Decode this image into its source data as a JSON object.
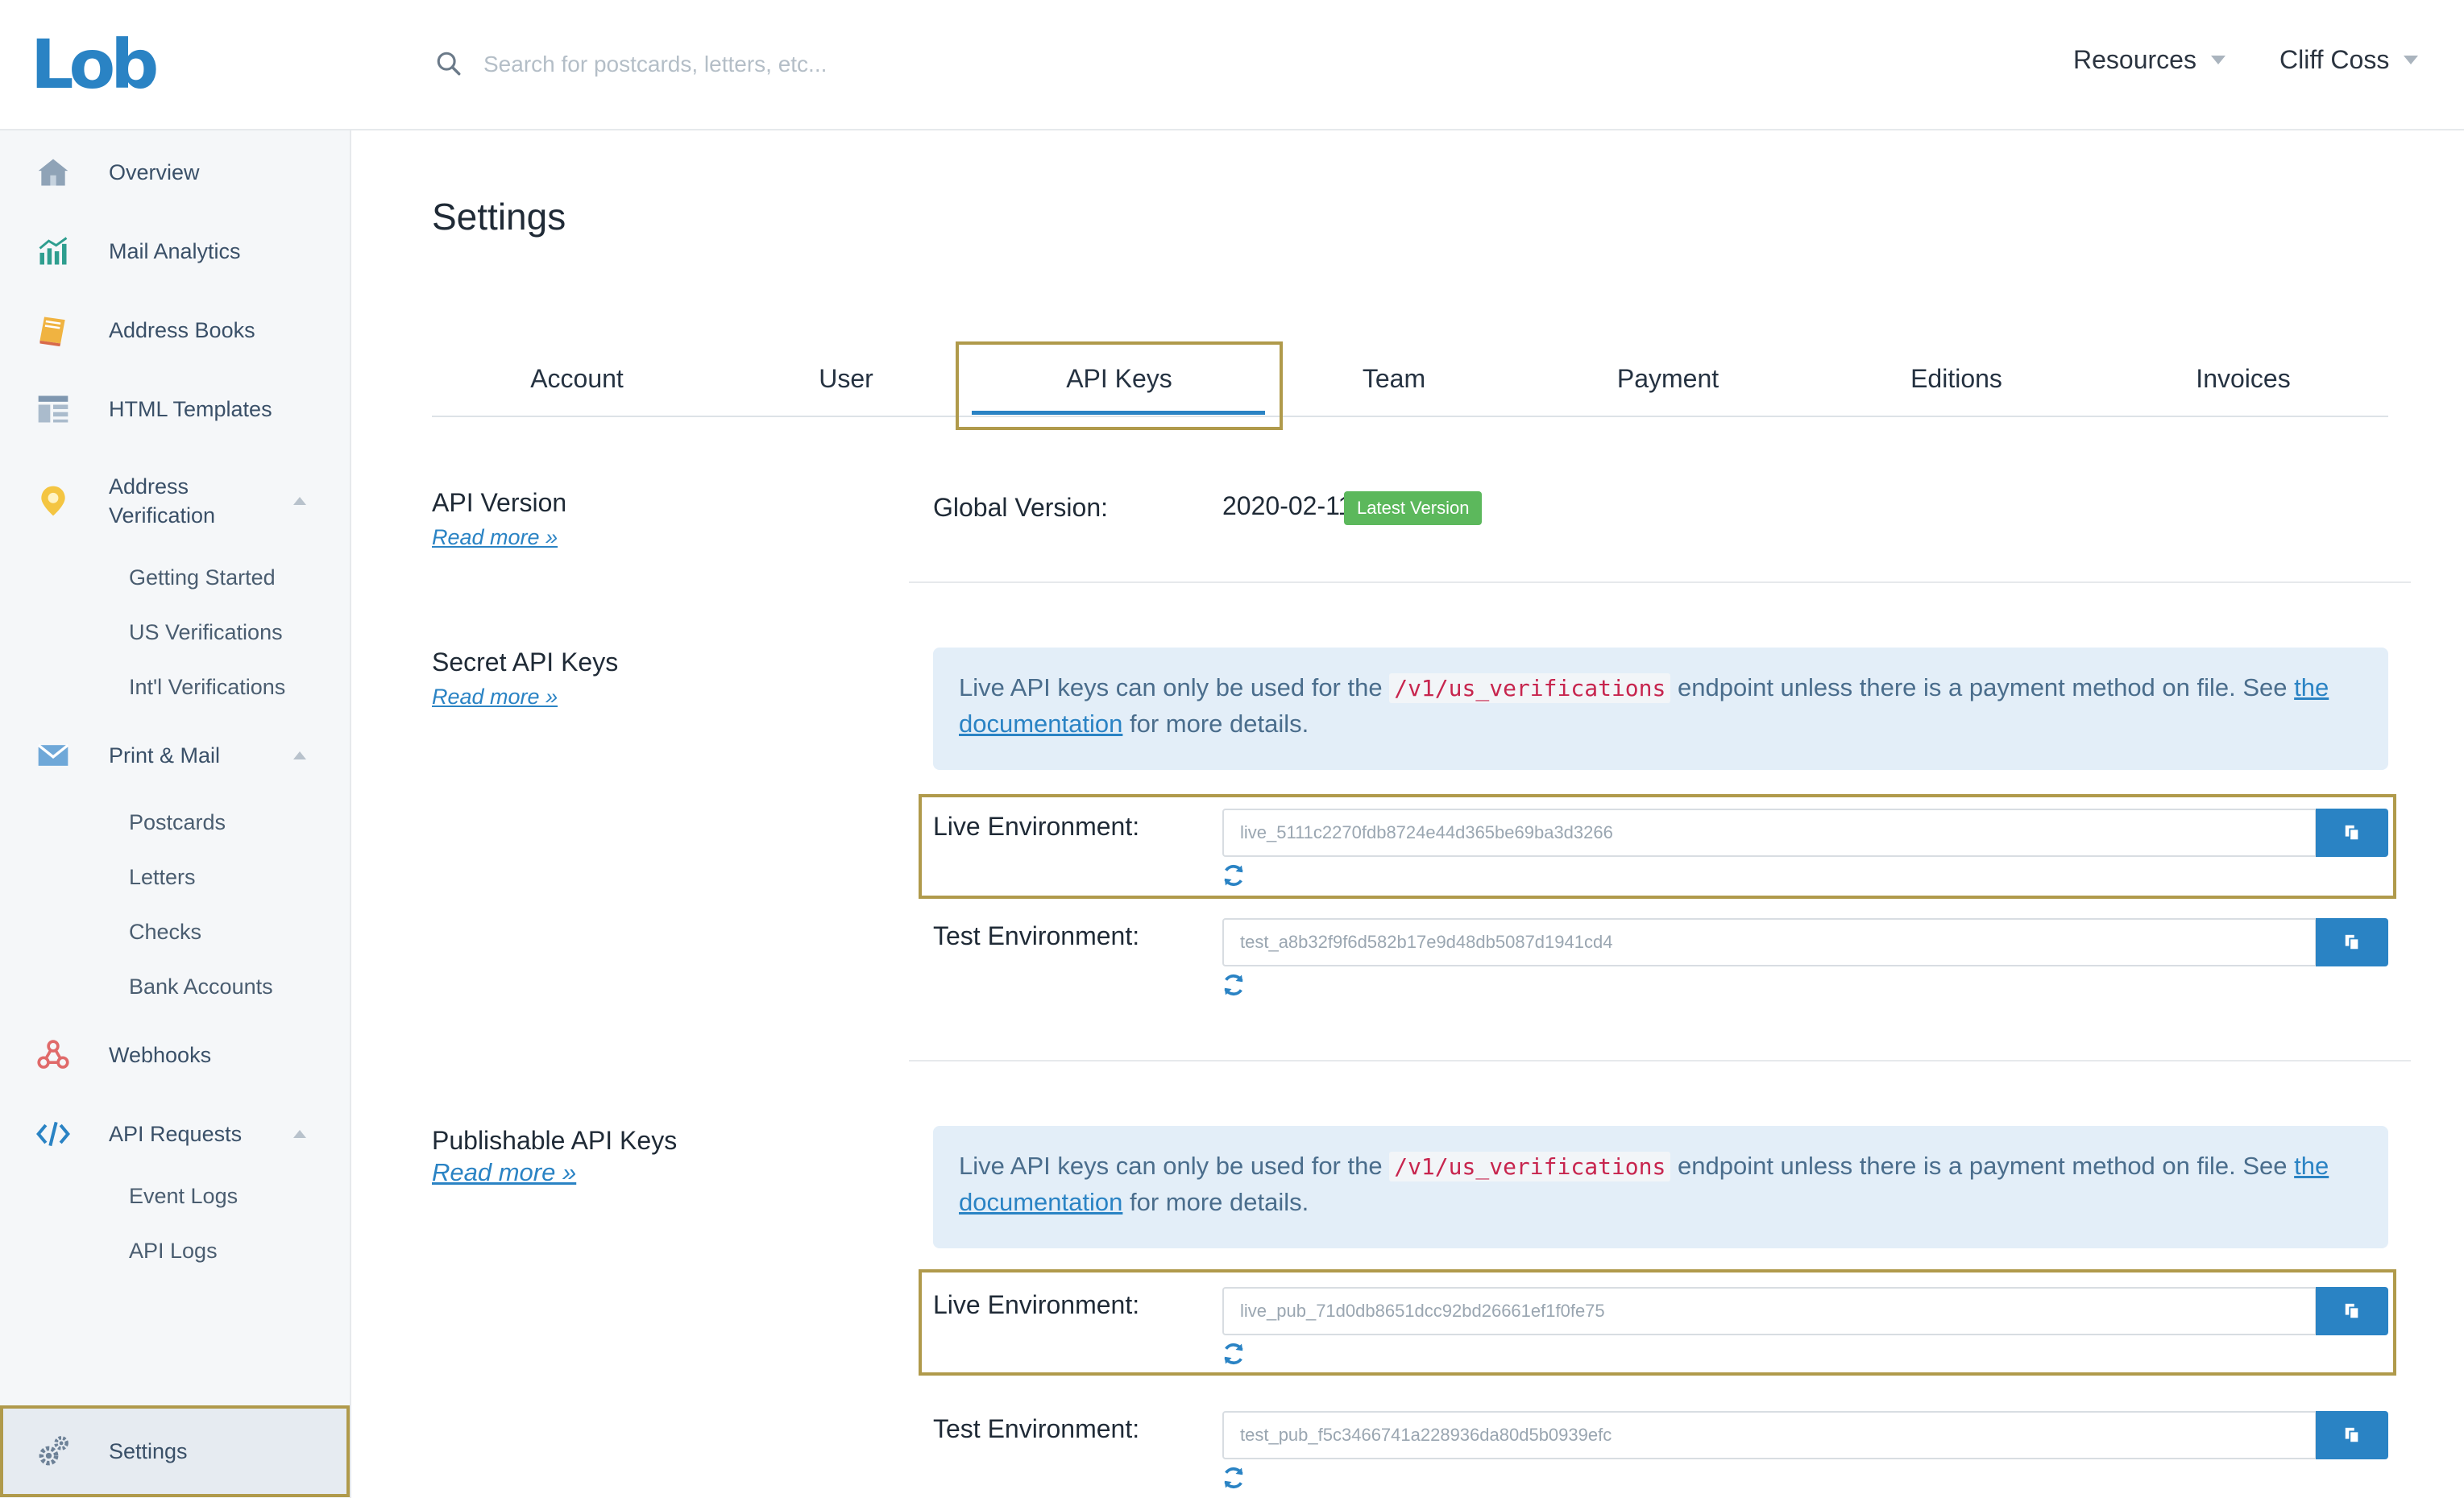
{
  "header": {
    "logo": "Lob",
    "search_placeholder": "Search for postcards, letters, etc...",
    "resources": "Resources",
    "user_name": "Cliff Coss"
  },
  "sidebar": {
    "overview": "Overview",
    "mail_analytics": "Mail Analytics",
    "address_books": "Address Books",
    "html_templates": "HTML Templates",
    "address_verification": "Address Verification",
    "av_sub": [
      "Getting Started",
      "US Verifications",
      "Int'l Verifications"
    ],
    "print_mail": "Print & Mail",
    "pm_sub": [
      "Postcards",
      "Letters",
      "Checks",
      "Bank Accounts"
    ],
    "webhooks": "Webhooks",
    "api_requests": "API Requests",
    "api_sub": [
      "Event Logs",
      "API Logs"
    ],
    "settings": "Settings"
  },
  "page": {
    "title": "Settings",
    "tabs": [
      "Account",
      "User",
      "API Keys",
      "Team",
      "Payment",
      "Editions",
      "Invoices"
    ],
    "active_tab": "API Keys"
  },
  "api_version": {
    "title": "API Version",
    "read_more": "Read more »",
    "label": "Global Version:",
    "value": "2020-02-11",
    "badge": "Latest Version"
  },
  "secret_keys": {
    "title": "Secret API Keys",
    "read_more": "Read more »",
    "notice_pre": "Live API keys can only be used for the ",
    "notice_code": "/v1/us_verifications",
    "notice_mid": " endpoint unless there is a payment method on file. See ",
    "notice_link": "the documentation",
    "notice_post": " for more details.",
    "live_label": "Live Environment:",
    "live_key": "live_5111c2270fdb8724e44d365be69ba3d3266",
    "test_label": "Test Environment:",
    "test_key": "test_a8b32f9f6d582b17e9d48db5087d1941cd4"
  },
  "publishable_keys": {
    "title": "Publishable API Keys",
    "read_more": "Read more »",
    "notice_pre": "Live API keys can only be used for the ",
    "notice_code": "/v1/us_verifications",
    "notice_mid": " endpoint unless there is a payment method on file. See ",
    "notice_link": "the documentation",
    "notice_post": " for more details.",
    "live_label": "Live Environment:",
    "live_key": "live_pub_71d0db8651dcc92bd26661ef1f0fe75",
    "test_label": "Test Environment:",
    "test_key": "test_pub_f5c3466741a228936da80d5b0939efc"
  },
  "colors": {
    "accent": "#2a83c4",
    "badge_green": "#5cb85c",
    "highlight": "#b09a4b",
    "notice_bg": "#e3eef8"
  }
}
